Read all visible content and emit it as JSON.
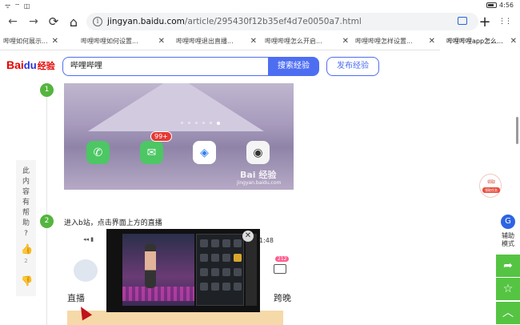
{
  "status": {
    "time": "4:56",
    "signal": "ᯤ ⌔ ◫"
  },
  "toolbar": {
    "back": "←",
    "forward": "→",
    "reload": "⟳",
    "home": "⌂",
    "info": "i",
    "url_host": "jingyan.baidu.com",
    "url_path": "/article/295430f12b35ef4d7e0050a7.html",
    "new_tab": "+",
    "menu": "⋮⋮"
  },
  "tabs": [
    {
      "label": "哔哩如何展示..."
    },
    {
      "label": "哔哩哔哩如何设置..."
    },
    {
      "label": "哔哩哔哩退出直播..."
    },
    {
      "label": "哔哩哔哩怎么开启..."
    },
    {
      "label": "哔哩哔哩怎样设置..."
    },
    {
      "label": "哔哩哔哩app怎么..."
    }
  ],
  "tab_close": "✕",
  "header": {
    "logo_bai": "Bai",
    "logo_du": "du",
    "logo_jy": "经验",
    "search_value": "哔哩哔哩",
    "search_button": "搜索经验",
    "publish_button": "发布经验"
  },
  "steps": [
    {
      "number": "1",
      "text": ""
    },
    {
      "number": "2",
      "text": "进入b站，点击界面上方的直播"
    }
  ],
  "image1": {
    "badge": "99+",
    "watermark": "Bai 经验",
    "watermark_url": "jingyan.baidu.com"
  },
  "image2": {
    "time": "1:48",
    "live_label": "直播",
    "right_label": "跨晚",
    "mail_badge": "212"
  },
  "video": {
    "close": "✕"
  },
  "feedback": {
    "question": [
      "此",
      "内",
      "容",
      "有",
      "帮",
      "助",
      "?"
    ],
    "like_count": "2"
  },
  "promo": {
    "title": "领取",
    "button": "领取任务"
  },
  "assist": {
    "label_line1": "辅助",
    "label_line2": "模式"
  }
}
